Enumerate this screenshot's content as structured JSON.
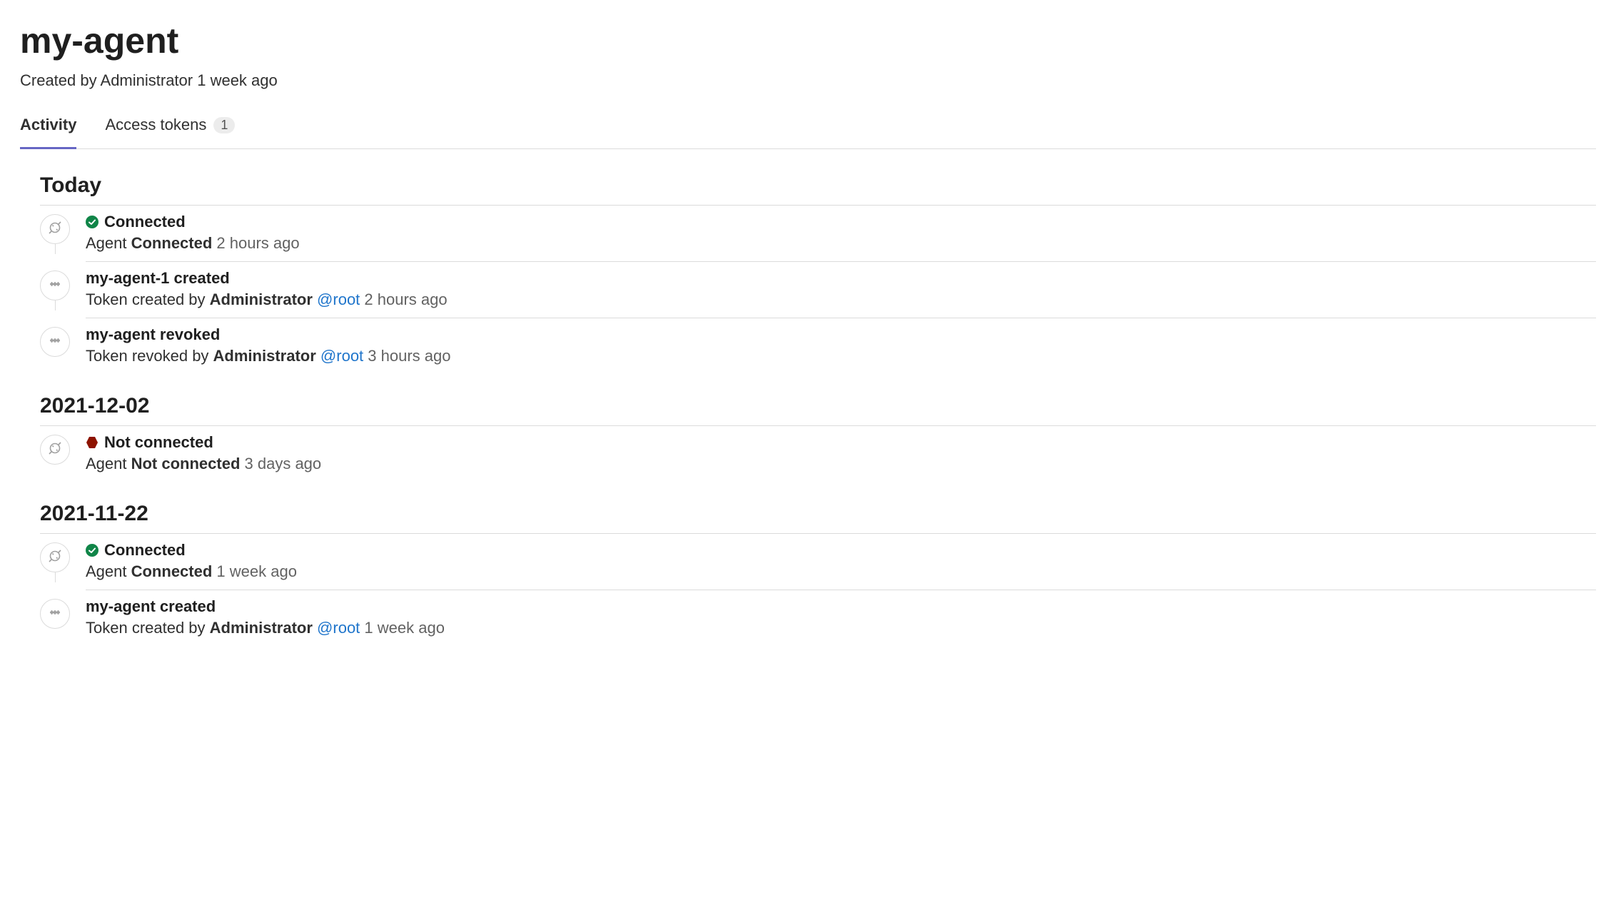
{
  "header": {
    "title": "my-agent",
    "subtitle_prefix": "Created by ",
    "subtitle_author": "Administrator",
    "subtitle_time": " 1 week ago"
  },
  "tabs": {
    "activity": "Activity",
    "access_tokens": "Access tokens",
    "access_tokens_count": "1"
  },
  "sections": [
    {
      "heading": "Today",
      "events": [
        {
          "icon": "plug",
          "status": "ok",
          "title": "Connected",
          "desc_prefix": "Agent ",
          "desc_bold": "Connected",
          "desc_author": "",
          "desc_user": "",
          "time": " 2 hours ago"
        },
        {
          "icon": "token",
          "status": "",
          "title": "my-agent-1 created",
          "desc_prefix": "Token created by ",
          "desc_bold": "Administrator",
          "desc_author": "",
          "desc_user": "@root",
          "time": " 2 hours ago"
        },
        {
          "icon": "token",
          "status": "",
          "title": "my-agent revoked",
          "desc_prefix": "Token revoked by ",
          "desc_bold": "Administrator",
          "desc_author": "",
          "desc_user": "@root",
          "time": " 3 hours ago",
          "last": true
        }
      ]
    },
    {
      "heading": "2021-12-02",
      "events": [
        {
          "icon": "plug",
          "status": "bad",
          "title": "Not connected",
          "desc_prefix": "Agent ",
          "desc_bold": "Not connected",
          "desc_author": "",
          "desc_user": "",
          "time": " 3 days ago",
          "last": true
        }
      ]
    },
    {
      "heading": "2021-11-22",
      "events": [
        {
          "icon": "plug",
          "status": "ok",
          "title": "Connected",
          "desc_prefix": "Agent ",
          "desc_bold": "Connected",
          "desc_author": "",
          "desc_user": "",
          "time": " 1 week ago"
        },
        {
          "icon": "token",
          "status": "",
          "title": "my-agent created",
          "desc_prefix": "Token created by ",
          "desc_bold": "Administrator",
          "desc_author": "",
          "desc_user": "@root",
          "time": " 1 week ago",
          "last": true
        }
      ]
    }
  ]
}
